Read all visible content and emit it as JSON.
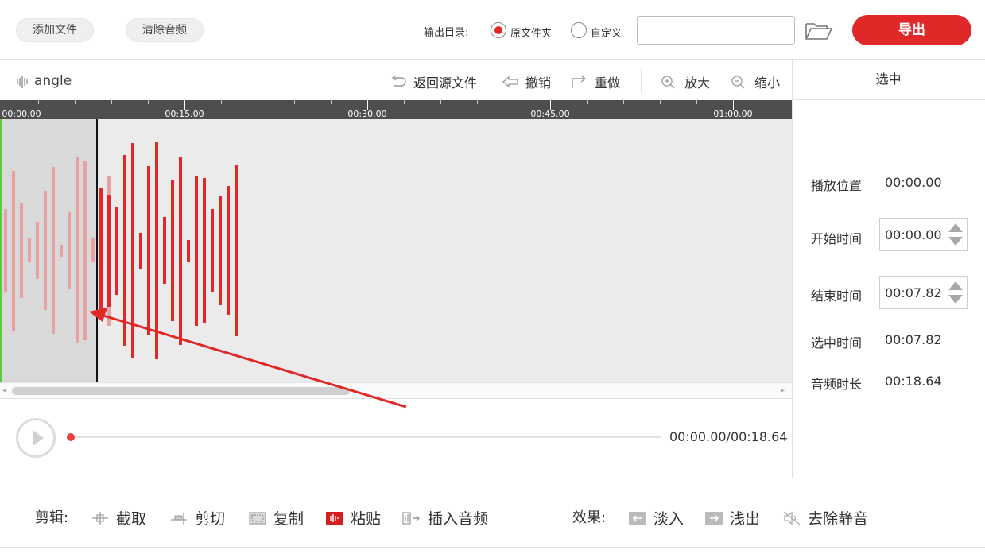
{
  "toolbar": {
    "add_file": "添加文件",
    "clear_audio": "清除音频",
    "output_dir_label": "输出目录:",
    "radio_original": "原文件夹",
    "radio_custom": "自定义",
    "path_value": "",
    "export_label": "导出"
  },
  "editor": {
    "file_name": "angle",
    "tools": {
      "revert": "返回源文件",
      "undo": "撤销",
      "redo": "重做",
      "zoom_in": "放大",
      "zoom_out": "缩小"
    }
  },
  "timeline": {
    "ticks": [
      "00:00.00",
      "00:15.00",
      "00:30.00",
      "00:45.00",
      "01:00.00"
    ]
  },
  "waveform": {
    "selected_bars": [
      0.35,
      0.67,
      0.4,
      0.1,
      0.24,
      0.5,
      0.7,
      0.05,
      0.32,
      0.78,
      0.75,
      0.1,
      0.44,
      0.63,
      0.15
    ],
    "bars": [
      0.53,
      0.47,
      0.37,
      0.8,
      0.9,
      0.15,
      0.71,
      0.91,
      0.28,
      0.59,
      0.79,
      0.09,
      0.63,
      0.61,
      0.35,
      0.46,
      0.54,
      0.72
    ]
  },
  "panel": {
    "title": "选中",
    "play_pos_label": "播放位置",
    "play_pos_value": "00:00.00",
    "start_label": "开始时间",
    "start_value": "00:00.00",
    "end_label": "结束时间",
    "end_value": "00:07.82",
    "sel_label": "选中时间",
    "sel_value": "00:07.82",
    "dur_label": "音频时长",
    "dur_value": "00:18.64"
  },
  "playback": {
    "time": "00:00.00/00:18.64",
    "progress": 0
  },
  "bottom": {
    "edit_label": "剪辑:",
    "trim": "截取",
    "cut": "剪切",
    "copy": "复制",
    "paste": "粘贴",
    "insert": "插入音频",
    "effect_label": "效果:",
    "fade_in": "淡入",
    "fade_out": "浅出",
    "remove_silence": "去除静音"
  },
  "colors": {
    "accent": "#e02828",
    "selection_start": "#5ccc3c"
  }
}
